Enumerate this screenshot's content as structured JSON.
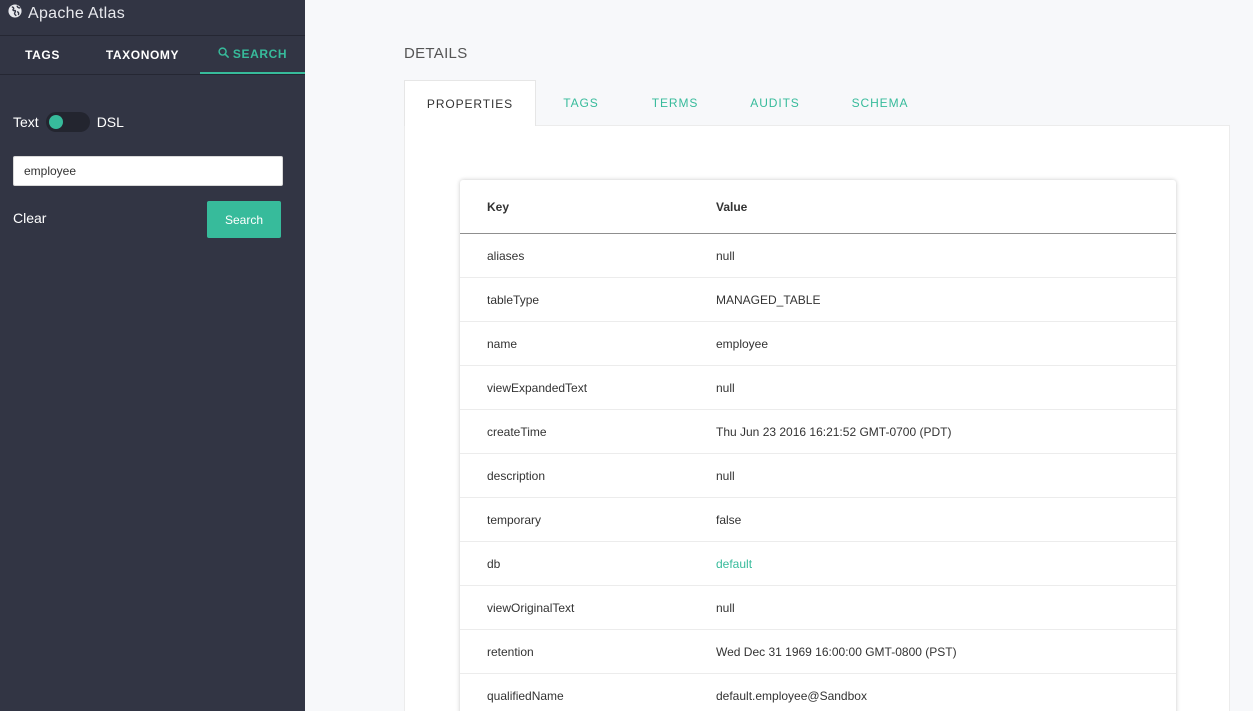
{
  "app": {
    "title": "Apache Atlas"
  },
  "sidebar": {
    "tabs": [
      {
        "label": "TAGS"
      },
      {
        "label": "TAXONOMY"
      },
      {
        "label": "SEARCH"
      }
    ],
    "toggle": {
      "left_label": "Text",
      "right_label": "DSL"
    },
    "search": {
      "value": "employee"
    },
    "clear_label": "Clear",
    "search_button_label": "Search"
  },
  "details": {
    "title": "DETAILS",
    "tabs": [
      {
        "label": "PROPERTIES"
      },
      {
        "label": "TAGS"
      },
      {
        "label": "TERMS"
      },
      {
        "label": "AUDITS"
      },
      {
        "label": "SCHEMA"
      }
    ],
    "table": {
      "headers": {
        "key": "Key",
        "value": "Value"
      },
      "rows": [
        {
          "key": "aliases",
          "value": "null"
        },
        {
          "key": "tableType",
          "value": "MANAGED_TABLE"
        },
        {
          "key": "name",
          "value": "employee"
        },
        {
          "key": "viewExpandedText",
          "value": "null"
        },
        {
          "key": "createTime",
          "value": "Thu Jun 23 2016 16:21:52 GMT-0700 (PDT)"
        },
        {
          "key": "description",
          "value": "null"
        },
        {
          "key": "temporary",
          "value": "false"
        },
        {
          "key": "db",
          "value": "default"
        },
        {
          "key": "viewOriginalText",
          "value": "null"
        },
        {
          "key": "retention",
          "value": "Wed Dec 31 1969 16:00:00 GMT-0800 (PST)"
        },
        {
          "key": "qualifiedName",
          "value": "default.employee@Sandbox"
        }
      ]
    }
  },
  "colors": {
    "accent": "#37bb9b",
    "sidebar_bg": "#323544"
  }
}
